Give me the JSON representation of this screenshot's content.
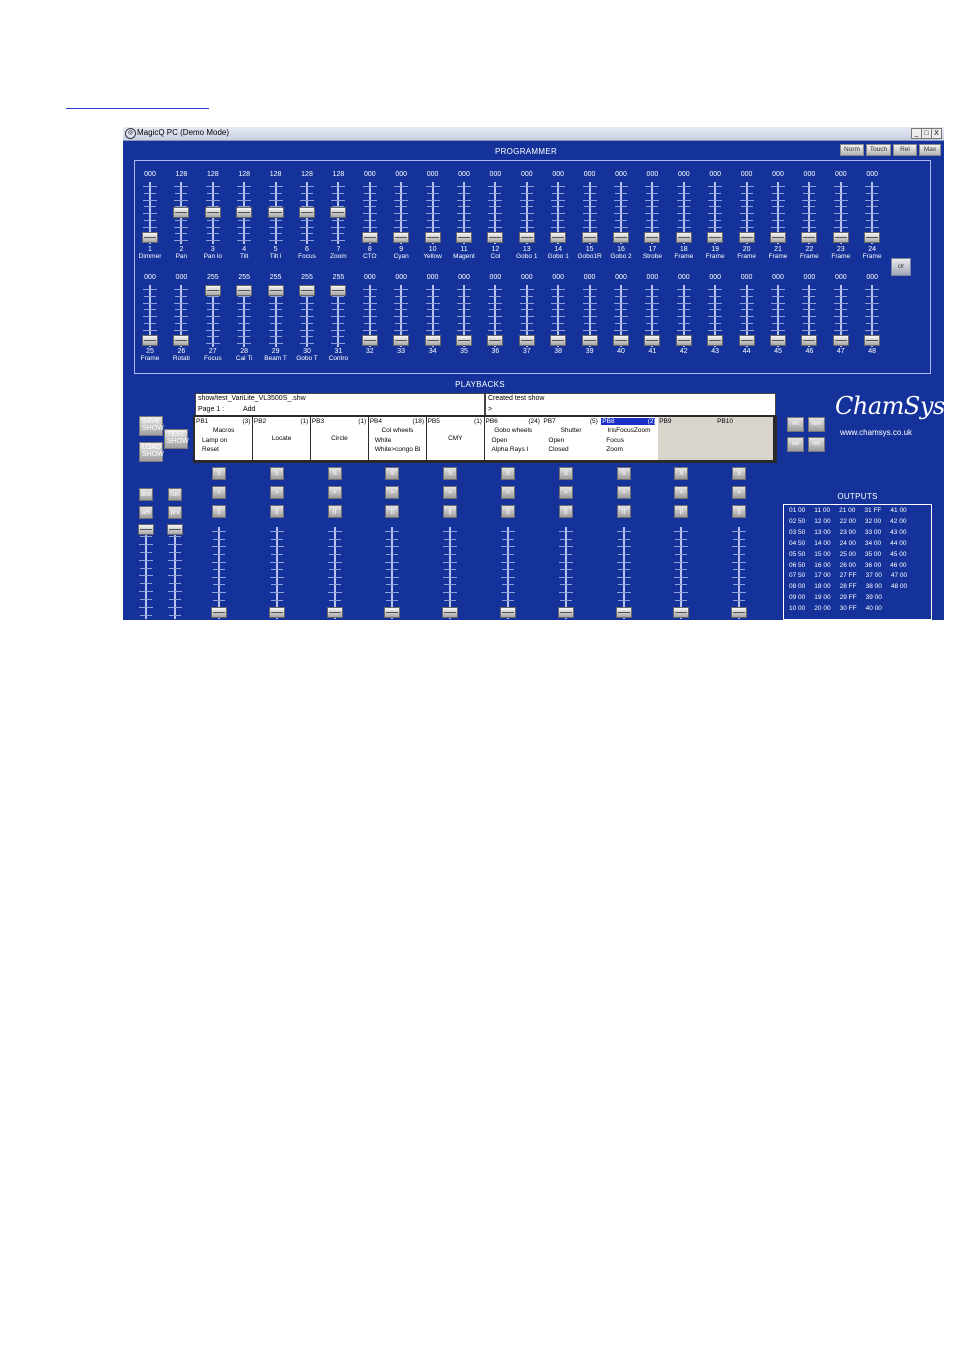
{
  "window": {
    "title": "MagicQ PC (Demo Mode)",
    "buttons": [
      "_",
      "□",
      "X"
    ],
    "app_icon": "chamsys-icon"
  },
  "programmer": {
    "heading": "PROGRAMMER",
    "mode_buttons": [
      "Norm",
      "Touch",
      "Rel",
      "Max"
    ],
    "clear_label": "clr",
    "row1": [
      {
        "value": "000",
        "num": "1",
        "name": "Dimmer"
      },
      {
        "value": "128",
        "num": "2",
        "name": "Pan"
      },
      {
        "value": "128",
        "num": "3",
        "name": "Pan lo"
      },
      {
        "value": "128",
        "num": "4",
        "name": "Tilt"
      },
      {
        "value": "128",
        "num": "5",
        "name": "Tilt l"
      },
      {
        "value": "128",
        "num": "6",
        "name": "Focus"
      },
      {
        "value": "128",
        "num": "7",
        "name": "Zoom"
      },
      {
        "value": "000",
        "num": "8",
        "name": "CTO"
      },
      {
        "value": "000",
        "num": "9",
        "name": "Cyan"
      },
      {
        "value": "000",
        "num": "10",
        "name": "Yellow"
      },
      {
        "value": "000",
        "num": "11",
        "name": "Magent"
      },
      {
        "value": "000",
        "num": "12",
        "name": "Col"
      },
      {
        "value": "000",
        "num": "13",
        "name": "Gobo 1"
      },
      {
        "value": "000",
        "num": "14",
        "name": "Gobo 1"
      },
      {
        "value": "000",
        "num": "15",
        "name": "Gobo1R"
      },
      {
        "value": "000",
        "num": "16",
        "name": "Gobo 2"
      },
      {
        "value": "000",
        "num": "17",
        "name": "Strobe"
      },
      {
        "value": "000",
        "num": "18",
        "name": "Frame"
      },
      {
        "value": "000",
        "num": "19",
        "name": "Frame"
      },
      {
        "value": "000",
        "num": "20",
        "name": "Frame"
      },
      {
        "value": "000",
        "num": "21",
        "name": "Frame"
      },
      {
        "value": "000",
        "num": "22",
        "name": "Frame"
      },
      {
        "value": "000",
        "num": "23",
        "name": "Frame"
      },
      {
        "value": "000",
        "num": "24",
        "name": "Frame"
      }
    ],
    "row2": [
      {
        "value": "000",
        "num": "25",
        "name": "Frame"
      },
      {
        "value": "000",
        "num": "26",
        "name": "Rotati"
      },
      {
        "value": "255",
        "num": "27",
        "name": "Focus"
      },
      {
        "value": "255",
        "num": "28",
        "name": "Cal Ti"
      },
      {
        "value": "255",
        "num": "29",
        "name": "Beam T"
      },
      {
        "value": "255",
        "num": "30",
        "name": "Gobo T"
      },
      {
        "value": "255",
        "num": "31",
        "name": "Contro"
      },
      {
        "value": "000",
        "num": "32",
        "name": ""
      },
      {
        "value": "000",
        "num": "33",
        "name": ""
      },
      {
        "value": "000",
        "num": "34",
        "name": ""
      },
      {
        "value": "000",
        "num": "35",
        "name": ""
      },
      {
        "value": "000",
        "num": "36",
        "name": ""
      },
      {
        "value": "000",
        "num": "37",
        "name": ""
      },
      {
        "value": "000",
        "num": "38",
        "name": ""
      },
      {
        "value": "000",
        "num": "39",
        "name": ""
      },
      {
        "value": "000",
        "num": "40",
        "name": ""
      },
      {
        "value": "000",
        "num": "41",
        "name": ""
      },
      {
        "value": "000",
        "num": "42",
        "name": ""
      },
      {
        "value": "000",
        "num": "43",
        "name": ""
      },
      {
        "value": "000",
        "num": "44",
        "name": ""
      },
      {
        "value": "000",
        "num": "45",
        "name": ""
      },
      {
        "value": "000",
        "num": "46",
        "name": ""
      },
      {
        "value": "000",
        "num": "47",
        "name": ""
      },
      {
        "value": "000",
        "num": "48",
        "name": ""
      }
    ]
  },
  "playbacks": {
    "heading": "PLAYBACKS",
    "show_file": "show/test_VariLite_VL3500S_.shw",
    "page_label": "Page 1 :",
    "page_action": "Add",
    "status_text": "Created test show",
    "status_prompt": ">",
    "left_buttons": {
      "save": [
        "SAVE",
        "SHOW"
      ],
      "load": [
        "LOAD",
        "SHOW"
      ],
      "test": [
        "TEST",
        "SHOW"
      ]
    },
    "items": [
      {
        "label": "PB1",
        "count": "(3)",
        "lines": [
          "Macros",
          "Lamp on",
          "Reset"
        ]
      },
      {
        "label": "PB2",
        "count": "(1)",
        "lines": [
          "",
          "Locate",
          ""
        ]
      },
      {
        "label": "PB3",
        "count": "(1)",
        "lines": [
          "",
          "Circle",
          ""
        ]
      },
      {
        "label": "PB4",
        "count": "(18)",
        "lines": [
          "Col wheels",
          "White",
          "White>congo Bl"
        ]
      },
      {
        "label": "PB5",
        "count": "(1)",
        "lines": [
          "",
          "CMY",
          ""
        ]
      },
      {
        "label": "PB6",
        "count": "(24)",
        "lines": [
          "Gobo wheels",
          "Open",
          "Alpha Rays I"
        ]
      },
      {
        "label": "PB7",
        "count": "(5)",
        "lines": [
          "Shutter",
          "Open",
          "Closed"
        ]
      },
      {
        "label": "PB8",
        "count": "(2)",
        "lines": [
          "IrisFocusZoom",
          "Focus",
          "Zoom"
        ]
      },
      {
        "label": "PB9",
        "count": "",
        "lines": [
          "",
          "",
          ""
        ]
      },
      {
        "label": "PB10",
        "count": "",
        "lines": [
          "",
          "",
          ""
        ]
      }
    ],
    "fader_buttons": [
      "S",
      ">",
      "||"
    ],
    "master_buttons": {
      "dbo": "dbo",
      "run": "run",
      "ab": "a/b",
      "prv": "prv"
    },
    "nav_buttons": [
      "rel",
      "rem",
      "sel",
      "rec"
    ]
  },
  "brand": {
    "logo": "ChamSys",
    "url": "www.chamsys.co.uk"
  },
  "outputs": {
    "heading": "OUTPUTS",
    "rows": [
      "01 00     11 00     21 00     31 FF     41 00",
      "02 50     12 00     22 00     32 00     42 00",
      "03 50     13 00     23 00     33 00     43 00",
      "04 50     14 00     24 00     34 00     44 00",
      "05 50     15 00     25 00     35 00     45 00",
      "06 50     16 00     26 00     36 00     46 00",
      "07 50     17 00     27 FF     37 00     47 00",
      "08 00     18 00     28 FF     38 00     48 00",
      "09 00     19 00     29 FF     39 00",
      "10 00     20 00     30 FF     40 00"
    ]
  }
}
